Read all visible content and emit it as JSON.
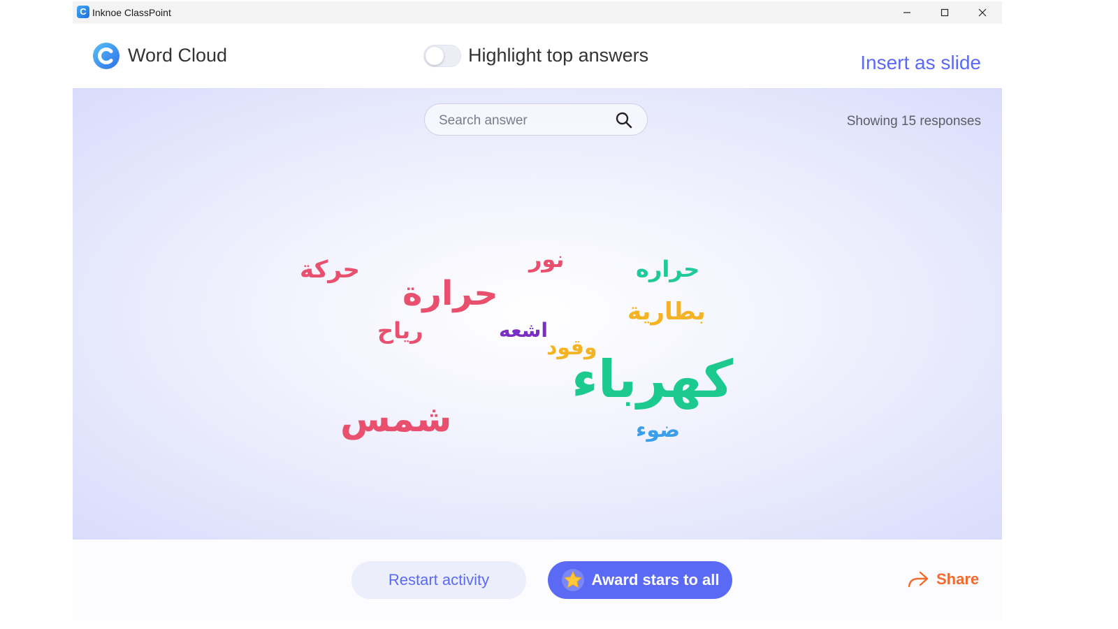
{
  "window": {
    "title": "Inknoe ClassPoint",
    "controls": {
      "minimize": "minimize-icon",
      "maximize": "maximize-icon",
      "close": "close-icon"
    }
  },
  "header": {
    "title": "Word Cloud",
    "toggle_label": "Highlight top answers",
    "toggle_on": false,
    "insert_label": "Insert as slide"
  },
  "search": {
    "placeholder": "Search answer",
    "value": ""
  },
  "status": {
    "showing": "Showing 15 responses"
  },
  "words": [
    {
      "text": "حركة",
      "color": "#e8506e"
    },
    {
      "text": "نور",
      "color": "#e8506e"
    },
    {
      "text": "حراره",
      "color": "#1fc99a"
    },
    {
      "text": "حرارة",
      "color": "#e8506e"
    },
    {
      "text": "بطارية",
      "color": "#f5b324"
    },
    {
      "text": "رياح",
      "color": "#e8506e"
    },
    {
      "text": "اشعه",
      "color": "#7a2ec4"
    },
    {
      "text": "وقود",
      "color": "#f5b324"
    },
    {
      "text": "كهرباء",
      "color": "#1cc98f"
    },
    {
      "text": "شمس",
      "color": "#e8506e"
    },
    {
      "text": "ضوء",
      "color": "#3a9ee8"
    }
  ],
  "footer": {
    "restart_label": "Restart activity",
    "award_label": "Award stars to all",
    "share_label": "Share"
  },
  "colors": {
    "accent": "#5b6af5",
    "share": "#f26a2e",
    "canvas_edge": "#d9dcfb"
  }
}
